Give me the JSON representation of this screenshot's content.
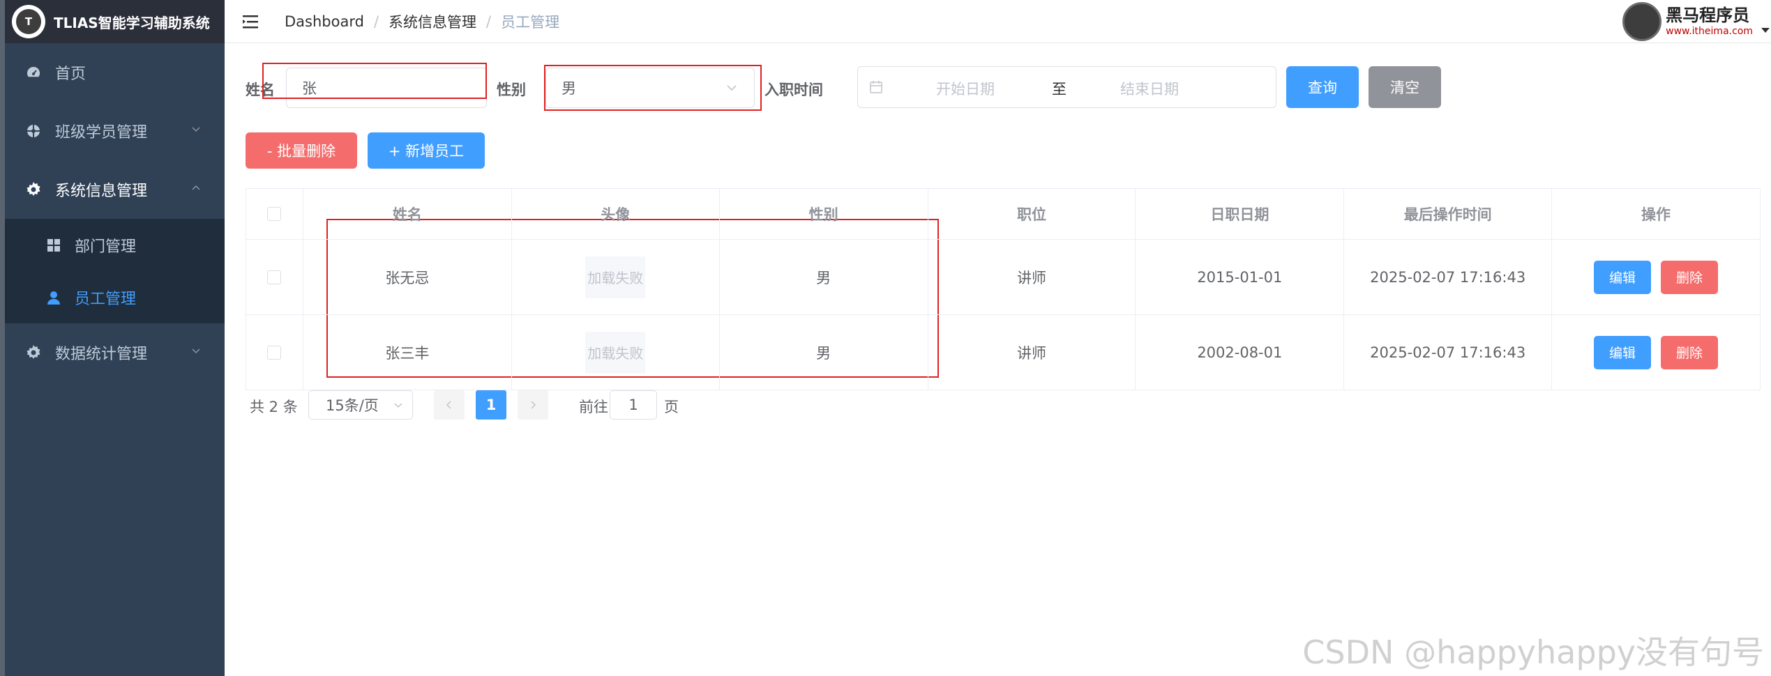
{
  "app": {
    "title": "TLIAS智能学习辅助系统"
  },
  "sidebar": {
    "items": [
      {
        "label": "首页",
        "icon": "dashboard-icon"
      },
      {
        "label": "班级学员管理",
        "icon": "wheel-icon"
      },
      {
        "label": "系统信息管理",
        "icon": "gear-icon",
        "expanded": true,
        "children": [
          {
            "label": "部门管理",
            "icon": "grid-icon"
          },
          {
            "label": "员工管理",
            "icon": "user-icon",
            "active": true
          }
        ]
      },
      {
        "label": "数据统计管理",
        "icon": "gear-icon"
      }
    ]
  },
  "header": {
    "breadcrumb": [
      "Dashboard",
      "系统信息管理",
      "员工管理"
    ],
    "brand_name": "黑马程序员",
    "brand_url": "www.itheima.com"
  },
  "search": {
    "name_label": "姓名",
    "name_value": "张",
    "gender_label": "性别",
    "gender_value": "男",
    "date_label": "入职时间",
    "start_placeholder": "开始日期",
    "range_separator": "至",
    "end_placeholder": "结束日期",
    "query_button": "查询",
    "clear_button": "清空"
  },
  "actions": {
    "batch_delete": "- 批量删除",
    "add_employee": "+ 新增员工"
  },
  "table": {
    "headers": [
      "姓名",
      "头像",
      "性别",
      "职位",
      "日职日期",
      "最后操作时间",
      "操作"
    ],
    "rows": [
      {
        "name": "张无忌",
        "avatar": "加载失败",
        "gender": "男",
        "position": "讲师",
        "date": "2015-01-01",
        "updated": "2025-02-07 17:16:43"
      },
      {
        "name": "张三丰",
        "avatar": "加载失败",
        "gender": "男",
        "position": "讲师",
        "date": "2002-08-01",
        "updated": "2025-02-07 17:16:43"
      }
    ],
    "edit_label": "编辑",
    "delete_label": "删除"
  },
  "pagination": {
    "total": "共 2 条",
    "page_size": "15条/页",
    "current_page": "1",
    "goto_label": "前往",
    "goto_value": "1",
    "page_word": "页"
  },
  "watermark": "CSDN @happyhappy没有句号",
  "colors": {
    "primary": "#409eff",
    "danger": "#f56c6c",
    "info": "#909399",
    "sidebar": "#304156",
    "active_menu": "#409eff"
  }
}
